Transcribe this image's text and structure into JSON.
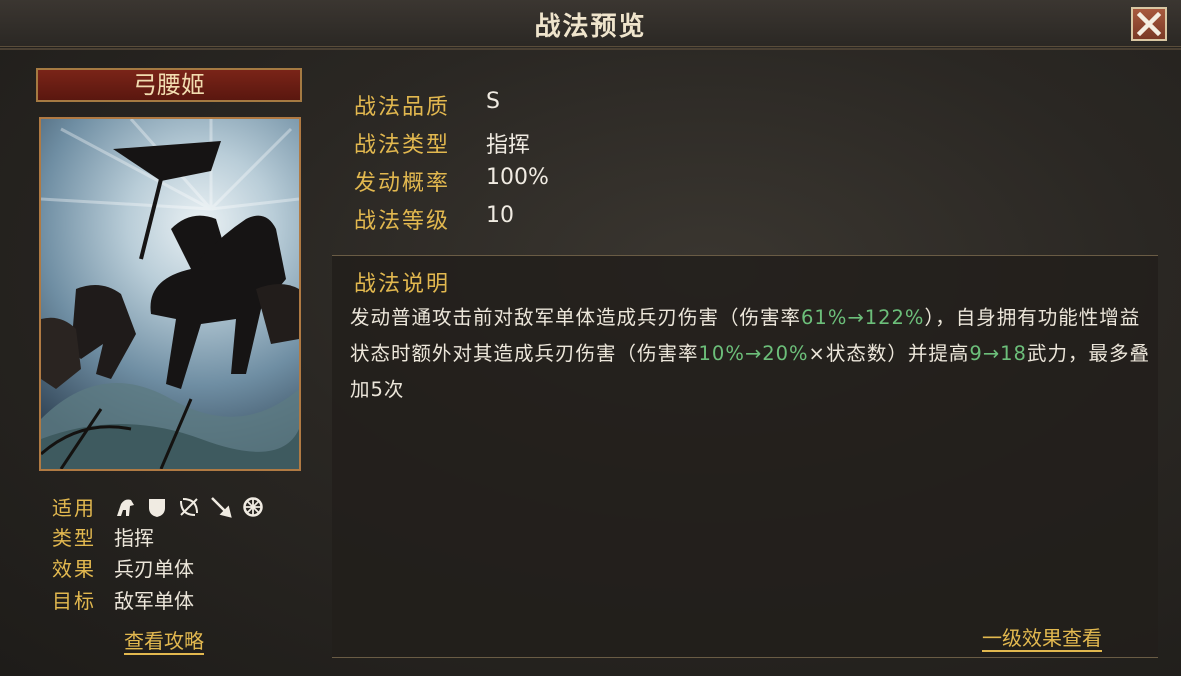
{
  "header": {
    "title": "战法预览"
  },
  "hero": {
    "name": "弓腰姬"
  },
  "attributes": {
    "applicable_label": "适用",
    "applicable_units": [
      "cavalry-icon",
      "shield-icon",
      "bow-icon",
      "spear-icon",
      "siege-icon"
    ],
    "type_label": "类型",
    "type_value": "指挥",
    "effect_label": "效果",
    "effect_value": "兵刃单体",
    "target_label": "目标",
    "target_value": "敌军单体"
  },
  "links": {
    "guide": "查看攻略",
    "level1": "一级效果查看"
  },
  "info": {
    "quality_label": "战法品质",
    "quality_value": "S",
    "type_label": "战法类型",
    "type_value": "指挥",
    "rate_label": "发动概率",
    "rate_value": "100%",
    "level_label": "战法等级",
    "level_value": "10"
  },
  "description": {
    "title": "战法说明",
    "seg1": "发动普通攻击前对敌军单体造成兵刃伤害（伤害率",
    "seg2": "61%→122%",
    "seg3": "），自身拥有功能性增益状态时额外对其造成兵刃伤害（伤害率",
    "seg4": "10%→20%",
    "seg5": "×状态数）并提高",
    "seg6": "9→18",
    "seg7": "武力，最多叠加5次"
  },
  "colors": {
    "accent_gold": "#e2b84f",
    "highlight_green": "#6cbf7a",
    "name_plate": "#7a2418"
  }
}
